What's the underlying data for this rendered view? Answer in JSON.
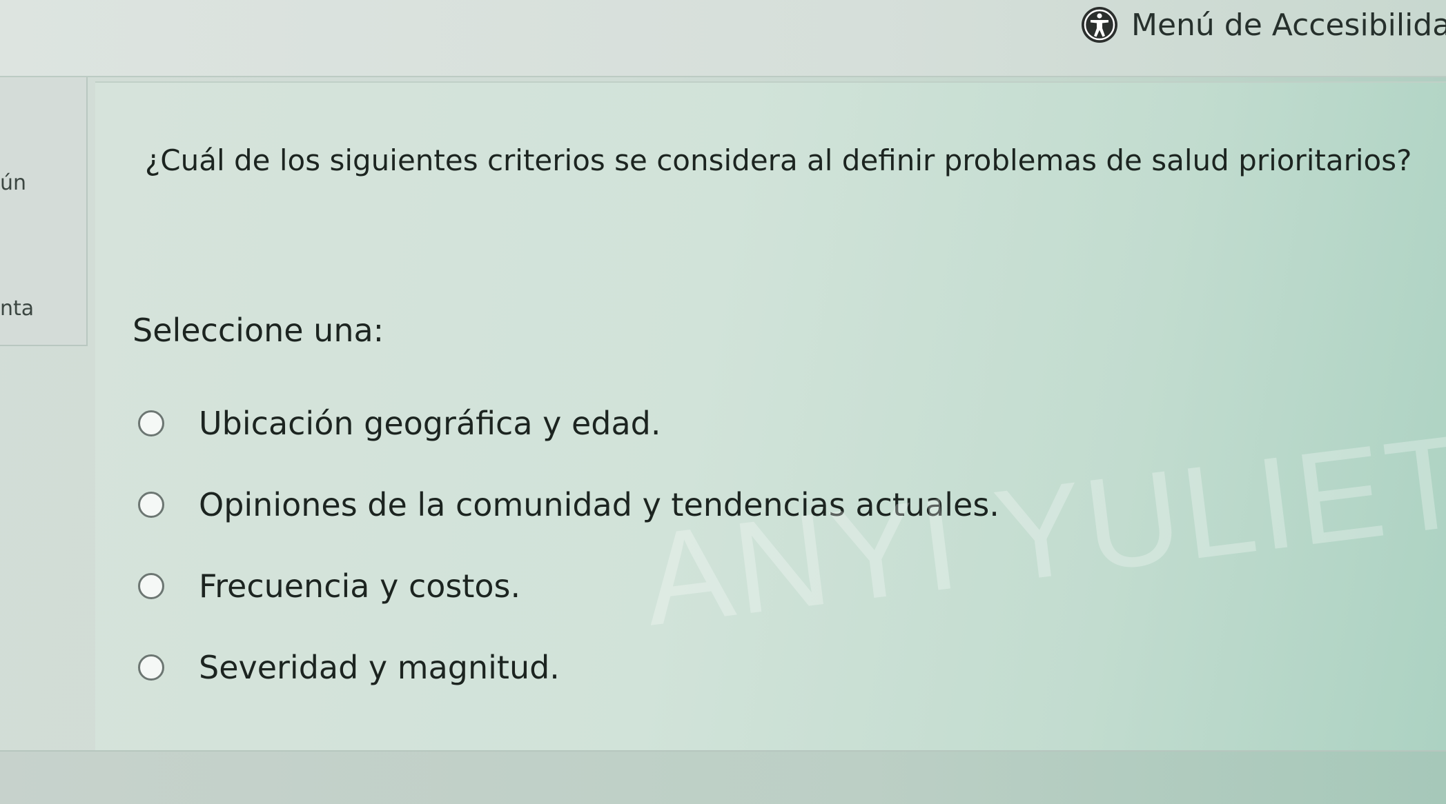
{
  "accessibility_menu": {
    "label": "Menú de Accesibilidad",
    "icon": "accessibility-person-icon"
  },
  "left_panel": {
    "text_1": "ún",
    "text_2": "nta"
  },
  "question": {
    "text": "¿Cuál de los siguientes criterios se considera al definir problemas de salud prioritarios?",
    "prompt": "Seleccione una:",
    "options": [
      {
        "label": "Ubicación geográfica y edad."
      },
      {
        "label": "Opiniones de la comunidad y tendencias actuales."
      },
      {
        "label": "Frecuencia y costos."
      },
      {
        "label": "Severidad y magnitud."
      }
    ]
  },
  "watermark": "ANYI YULIET"
}
